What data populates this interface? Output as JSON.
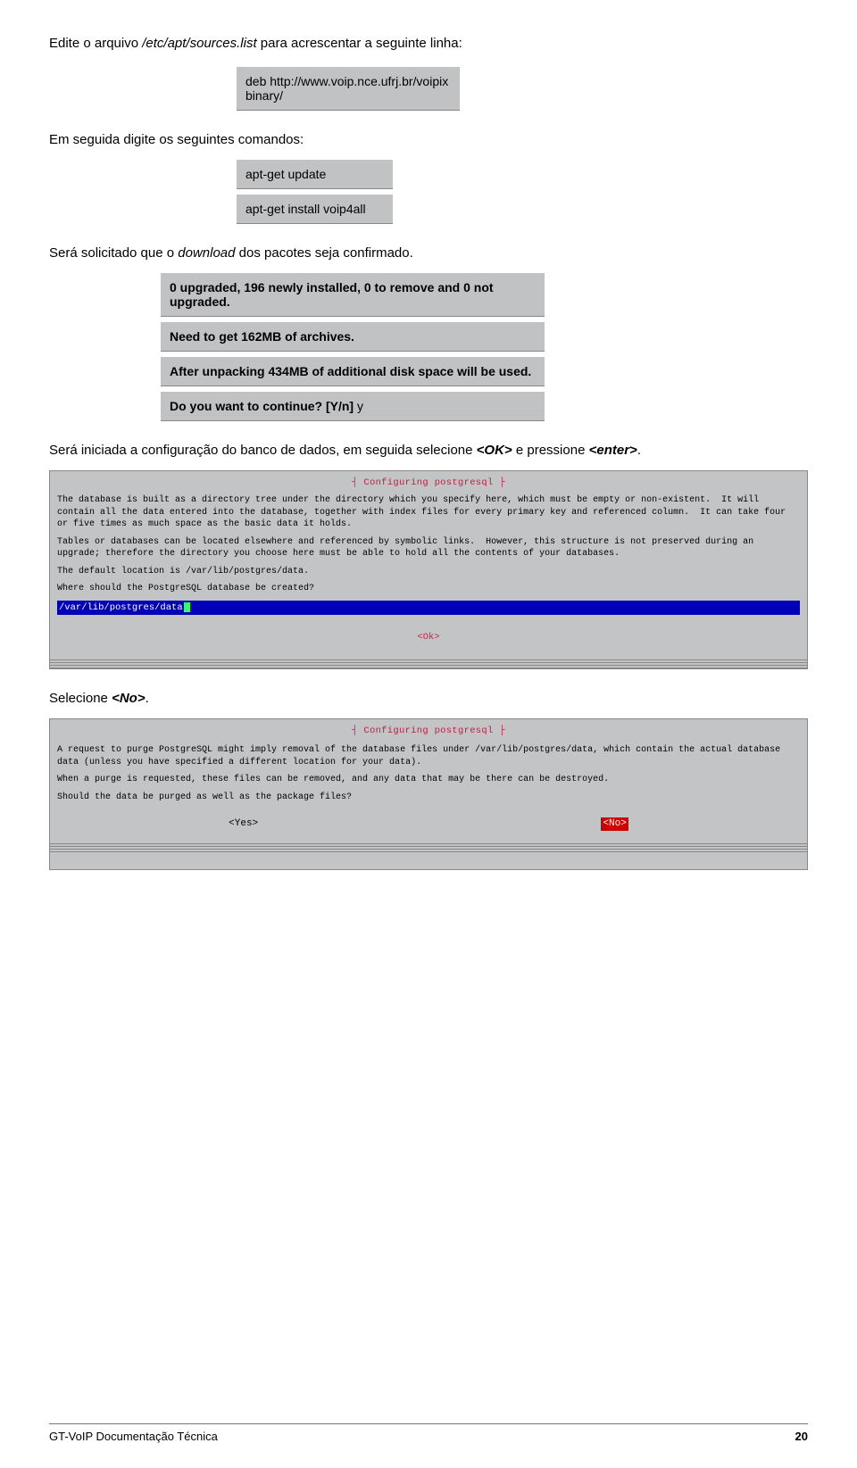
{
  "intro": {
    "prefix": "Edite o arquivo ",
    "path": "/etc/apt/sources.list",
    "suffix": " para acrescentar a seguinte linha:"
  },
  "deb_line": "deb http://www.voip.nce.ufrj.br/voipix   binary/",
  "cmds_intro": "Em seguida digite os seguintes comandos:",
  "cmd_update": "apt-get update",
  "cmd_install": "apt-get install voip4all",
  "download": {
    "prefix": "Será solicitado que o ",
    "italic": "download",
    "suffix": " dos pacotes seja confirmado."
  },
  "apt_output": {
    "line1": "0 upgraded, 196 newly installed, 0 to remove and 0 not upgraded.",
    "line2": "Need to get 162MB of archives.",
    "line3": "After unpacking 434MB of additional disk space will be used.",
    "line4_prefix": "Do you want to continue? [Y/n] ",
    "line4_ans": "y"
  },
  "config_line": {
    "prefix": "Será iniciada a configuração do banco de dados, em seguida selecione ",
    "ok": "<OK>",
    "mid": " e pressione ",
    "enter": "<enter>",
    "suffix": "."
  },
  "screenshot1": {
    "title": "┤ Configuring postgresql ├",
    "t1": "The database is built as a directory tree under the directory which you specify here, which must be empty or non-existent.  It will contain all the data entered into the database, together with index files for every primary key and referenced column.  It can take four or five times as much space as the basic data it holds.",
    "t2": "Tables or databases can be located elsewhere and referenced by symbolic links.  However, this structure is not preserved during an upgrade; therefore the directory you choose here must be able to hold all the contents of your databases.",
    "t3": "The default location is /var/lib/postgres/data.",
    "t4": "Where should the PostgreSQL database be created?",
    "input": "/var/lib/postgres/data",
    "ok": "<Ok>"
  },
  "select_no": {
    "prefix": "Selecione ",
    "no": "<No>",
    "suffix": "."
  },
  "screenshot2": {
    "title": "┤ Configuring postgresql ├",
    "t1": "A request to purge PostgreSQL might imply removal of the database files under /var/lib/postgres/data, which contain the actual database data (unless you have specified a different location for your data).",
    "t2": "When a purge is requested, these files can be removed, and any data that may be there can be destroyed.",
    "t3": "Should the data be purged as well as the package files?",
    "yes": "<Yes>",
    "no": "<No>"
  },
  "footer": {
    "left": "GT-VoIP Documentação Técnica",
    "right": "20"
  }
}
